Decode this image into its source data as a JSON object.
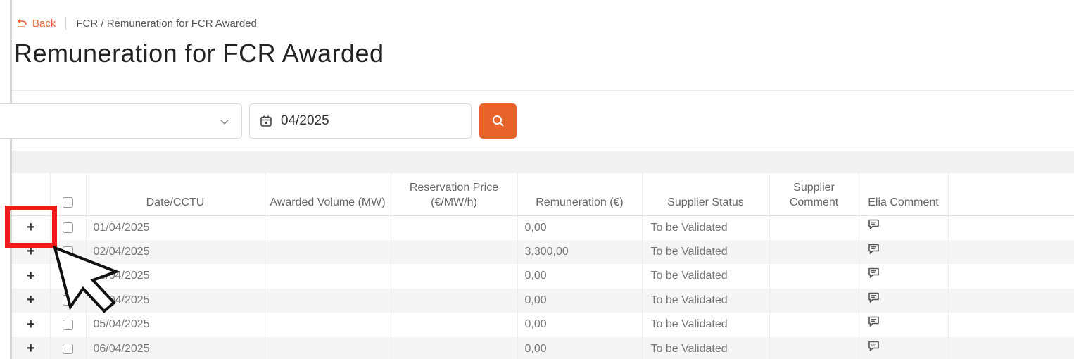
{
  "breadcrumb": {
    "back_label": "Back",
    "path": "FCR / Remuneration for FCR Awarded"
  },
  "page": {
    "title": "Remuneration for FCR Awarded"
  },
  "filters": {
    "select_value": "",
    "date_value": "04/2025",
    "search_icon": "search-icon",
    "calendar_icon": "calendar-icon"
  },
  "table": {
    "columns": [
      {
        "key": "expand",
        "label": ""
      },
      {
        "key": "select",
        "label": ""
      },
      {
        "key": "date",
        "label": "Date/CCTU"
      },
      {
        "key": "awarded_volume",
        "label": "Awarded Volume (MW)"
      },
      {
        "key": "reservation_price",
        "label": "Reservation Price (€/MW/h)"
      },
      {
        "key": "remuneration",
        "label": "Remuneration (€)"
      },
      {
        "key": "supplier_status",
        "label": "Supplier Status"
      },
      {
        "key": "supplier_comment",
        "label": "Supplier Comment"
      },
      {
        "key": "elia_comment",
        "label": "Elia Comment"
      },
      {
        "key": "extra",
        "label": ""
      }
    ],
    "rows": [
      {
        "expand": "+",
        "date": "01/04/2025",
        "awarded_volume": "",
        "reservation_price": "",
        "remuneration": "0,00",
        "supplier_status": "To be Validated",
        "supplier_comment": "",
        "elia_comment_icon": "comment-icon"
      },
      {
        "expand": "+",
        "date": "02/04/2025",
        "awarded_volume": "",
        "reservation_price": "",
        "remuneration": "3.300,00",
        "supplier_status": "To be Validated",
        "supplier_comment": "",
        "elia_comment_icon": "comment-icon"
      },
      {
        "expand": "+",
        "date": "03/04/2025",
        "awarded_volume": "",
        "reservation_price": "",
        "remuneration": "0,00",
        "supplier_status": "To be Validated",
        "supplier_comment": "",
        "elia_comment_icon": "comment-icon"
      },
      {
        "expand": "+",
        "date": "04/04/2025",
        "awarded_volume": "",
        "reservation_price": "",
        "remuneration": "0,00",
        "supplier_status": "To be Validated",
        "supplier_comment": "",
        "elia_comment_icon": "comment-icon"
      },
      {
        "expand": "+",
        "date": "05/04/2025",
        "awarded_volume": "",
        "reservation_price": "",
        "remuneration": "0,00",
        "supplier_status": "To be Validated",
        "supplier_comment": "",
        "elia_comment_icon": "comment-icon"
      },
      {
        "expand": "+",
        "date": "06/04/2025",
        "awarded_volume": "",
        "reservation_price": "",
        "remuneration": "0,00",
        "supplier_status": "To be Validated",
        "supplier_comment": "",
        "elia_comment_icon": "comment-icon"
      }
    ]
  },
  "annotations": {
    "highlight_color": "#ef1a1a",
    "highlight_target": "row 1 expand button",
    "pointer": "cursor-arrow-icon"
  },
  "colors": {
    "accent": "#e8622c",
    "row_stripe": "#f5f5f5"
  }
}
